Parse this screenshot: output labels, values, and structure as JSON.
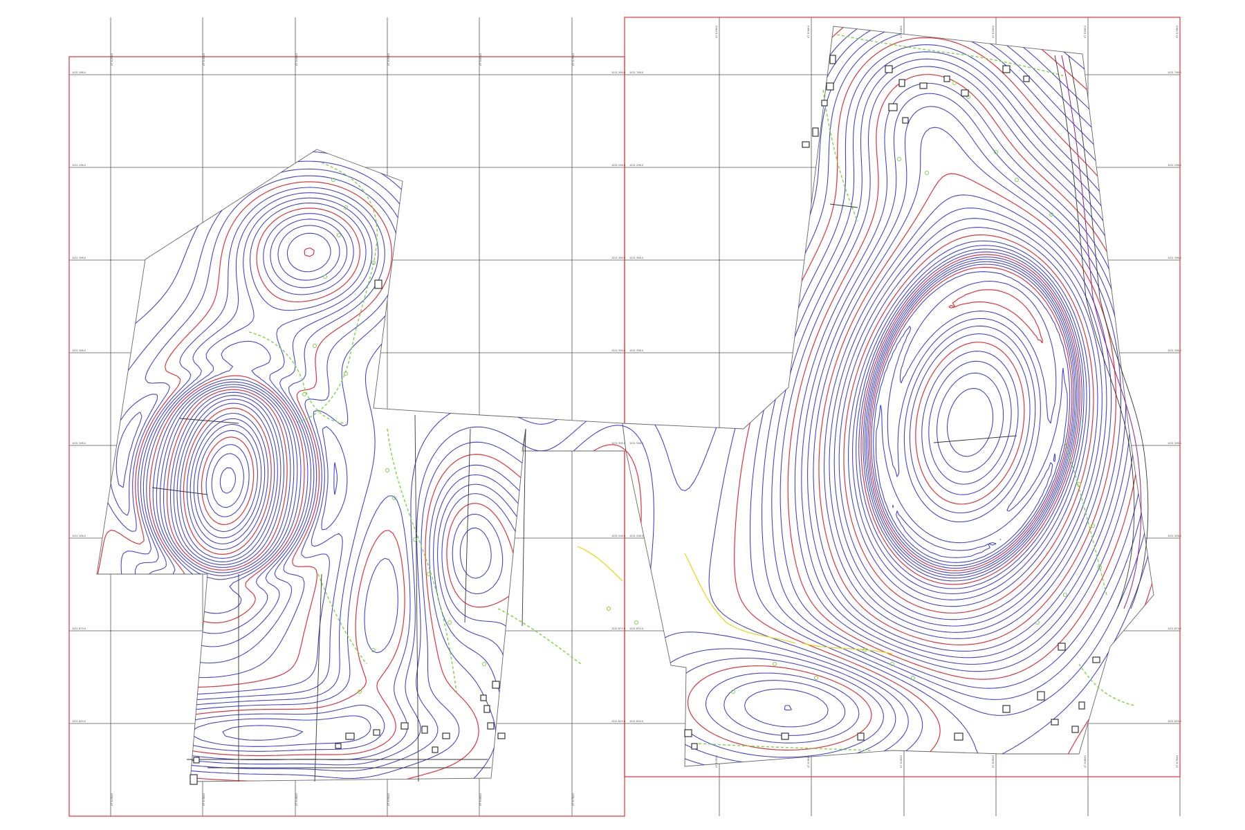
{
  "map": {
    "colors": {
      "contour_minor": "#2a2ad8",
      "contour_major": "#e0323a",
      "contour_pink": "#d01a9a",
      "vegetation": "#7ad63a",
      "water_yellow": "#e8d81a",
      "sheet_border": "#e0323a",
      "grid": "#555555"
    },
    "left_sheet": {
      "row_labels": [
        "1021 598.0",
        "1021 298.0",
        "1021 398.0",
        "1021 398.0",
        "1021 398.0",
        "1021 208.0",
        "1021 879.0",
        "1021 829.0"
      ],
      "col_labels": [
        "47 6.2940",
        "47 6.3940",
        "47 6.4940",
        "47 6.5940",
        "47 6.6940",
        "47 6.7940"
      ]
    },
    "right_sheet": {
      "row_labels": [
        "1021 798.0",
        "1021 298.0",
        "1021 398.0",
        "1021 398.0",
        "1021 398.0",
        "1021 208.0",
        "1021 879.0",
        "1021 829.0"
      ],
      "col_labels": [
        "47 8.2940",
        "47 8.3940",
        "47 8.4940",
        "47 8.5940",
        "47 8.6940",
        "47 8.7940"
      ]
    }
  }
}
